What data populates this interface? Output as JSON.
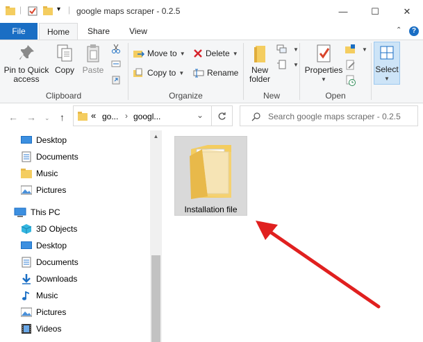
{
  "window": {
    "title": "google maps scraper - 0.2.5",
    "minimize_glyph": "—",
    "maximize_glyph": "☐",
    "close_glyph": "✕"
  },
  "tabs": {
    "file": "File",
    "home": "Home",
    "share": "Share",
    "view": "View",
    "collapse_glyph": "⌃",
    "help_glyph": "?"
  },
  "ribbon": {
    "clipboard": {
      "label": "Clipboard",
      "pin_to_quick_access_line1": "Pin to Quick",
      "pin_to_quick_access_line2": "access",
      "copy": "Copy",
      "paste": "Paste"
    },
    "organize": {
      "label": "Organize",
      "move_to": "Move to",
      "copy_to": "Copy to",
      "delete": "Delete",
      "rename": "Rename"
    },
    "new": {
      "label": "New",
      "new_folder_line1": "New",
      "new_folder_line2": "folder"
    },
    "open": {
      "label": "Open",
      "properties": "Properties"
    },
    "select": {
      "label": "Select"
    }
  },
  "address": {
    "overflow_glyph": "«",
    "crumbs": [
      "go...",
      "googl..."
    ],
    "crumb_sep_glyph": "›",
    "dropdown_glyph": "⌄",
    "search_placeholder": "Search google maps scraper - 0.2.5"
  },
  "nav": {
    "items": [
      {
        "label": "Desktop",
        "icon": "desktop-icon"
      },
      {
        "label": "Documents",
        "icon": "documents-icon"
      },
      {
        "label": "Music",
        "icon": "folder-icon"
      },
      {
        "label": "Pictures",
        "icon": "pictures-icon"
      },
      {
        "label": "This PC",
        "icon": "this-pc-icon"
      },
      {
        "label": "3D Objects",
        "icon": "3d-objects-icon"
      },
      {
        "label": "Desktop",
        "icon": "desktop-icon"
      },
      {
        "label": "Documents",
        "icon": "documents-icon"
      },
      {
        "label": "Downloads",
        "icon": "downloads-icon"
      },
      {
        "label": "Music",
        "icon": "music-icon"
      },
      {
        "label": "Pictures",
        "icon": "pictures-icon"
      },
      {
        "label": "Videos",
        "icon": "videos-icon"
      }
    ]
  },
  "content": {
    "items": [
      {
        "label": "Installation file",
        "icon": "folder-icon",
        "selected": true
      }
    ]
  },
  "colors": {
    "accent": "#1a6ec4",
    "annotation_arrow": "#e0201f",
    "folder": "#f4cd60"
  }
}
